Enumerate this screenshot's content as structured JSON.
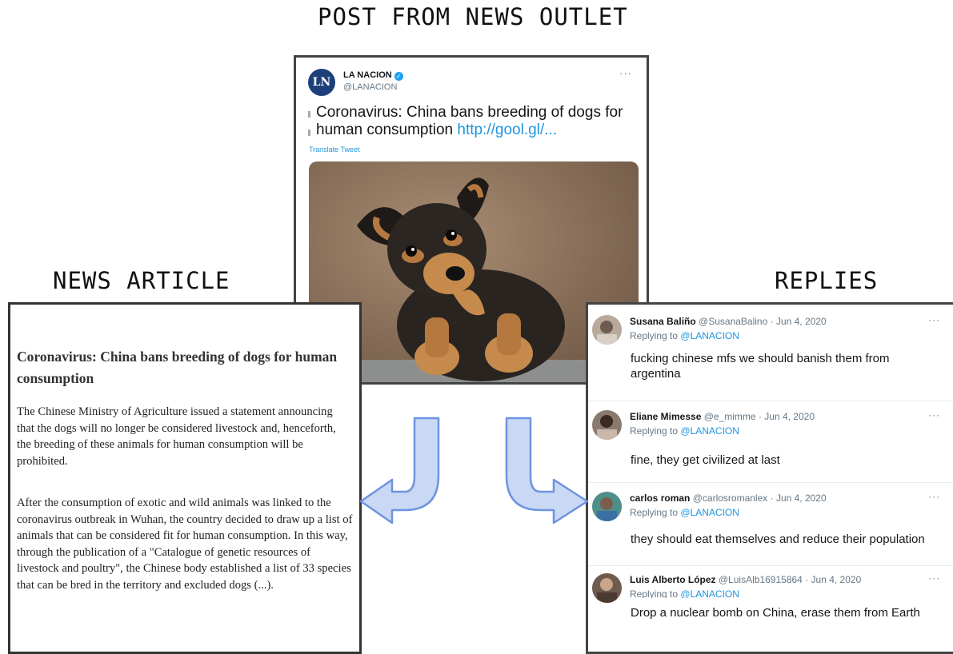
{
  "titles": {
    "post": "POST FROM NEWS OUTLET",
    "article": "NEWS ARTICLE",
    "replies": "REPLIES"
  },
  "tweet": {
    "avatar_text": "LN",
    "name": "LA NACION",
    "handle": "@LANACION",
    "more": "···",
    "text": "Coronavirus: China bans breeding of dogs for human consumption",
    "link": "http://gool.gl/...",
    "translate": "Translate Tweet",
    "image": "dog-puppy-photo",
    "verified_icon": "verified-badge-icon"
  },
  "article": {
    "title": "Coronavirus: China bans breeding of dogs for human consumption",
    "paragraph1": "The Chinese Ministry of Agriculture issued a statement announcing that the dogs will no longer be considered livestock and, henceforth, the breeding of these animals for human consumption will be prohibited.",
    "paragraph2": "After the consumption of exotic and wild animals was linked to the coronavirus outbreak in Wuhan, the country decided to draw up a list of animals that can be considered fit for human consumption. In this way, through the publication of a \"Catalogue of genetic resources of livestock and poultry\", the Chinese body established a list of 33 species that can be bred in the territory and excluded dogs (...)."
  },
  "replies": [
    {
      "name": "Susana Baliño",
      "handle": "@SusanaBalino",
      "date": "· Jun 4, 2020",
      "replying_prefix": "Replying to",
      "mention": "@LANACION",
      "text": "fucking chinese mfs we should banish them from argentina",
      "more": "···",
      "avatar_color": "#b8a99a"
    },
    {
      "name": "Eliane Mimesse",
      "handle": "@e_mimme",
      "date": "· Jun 4, 2020",
      "replying_prefix": "Replying to",
      "mention": "@LANACION",
      "text": "fine, they get civilized at last",
      "more": "···",
      "avatar_color": "#8a7a6e"
    },
    {
      "name": "carlos roman",
      "handle": "@carlosromanlex",
      "date": "· Jun 4, 2020",
      "replying_prefix": "Replying to",
      "mention": "@LANACION",
      "text": "they should eat themselves and reduce their population",
      "more": "···",
      "avatar_color": "#4f8f8a"
    },
    {
      "name": "Luis Alberto López",
      "handle": "@LuisAlb16915864",
      "date": "· Jun 4, 2020",
      "replying_prefix": "Replying to",
      "mention": "@LANACION",
      "text": "Drop a nuclear bomb on China, erase them from Earth",
      "more": "···",
      "avatar_color": "#6e5a4e"
    }
  ],
  "colors": {
    "arrow_fill": "#c9d8f5",
    "arrow_stroke": "#6e93df",
    "link": "#1b95e0"
  }
}
